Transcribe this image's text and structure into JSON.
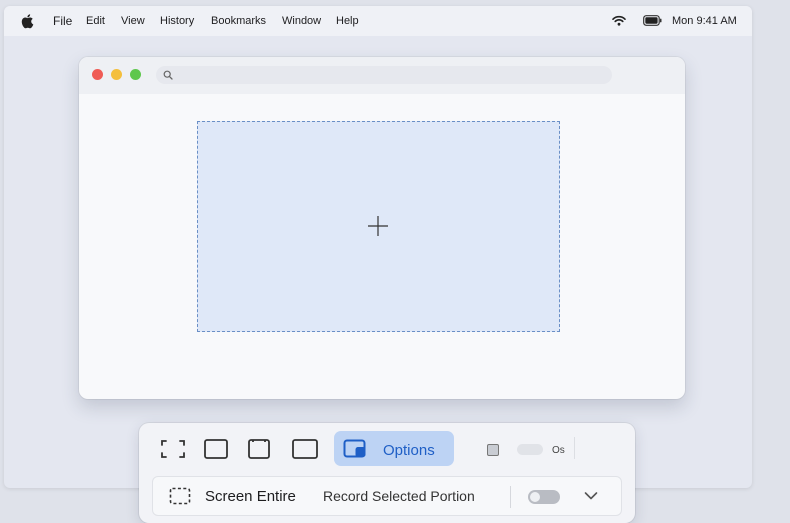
{
  "menubar": {
    "apple_icon": "apple-logo-icon",
    "items": [
      "File",
      "Edit",
      "View",
      "History",
      "Bookmarks",
      "Window",
      "Help"
    ],
    "wifi_icon": "wifi-icon",
    "battery_icon": "battery-icon",
    "clock": "Mon 9:41 AM"
  },
  "browser": {
    "search_placeholder": "",
    "search_icon": "search-icon",
    "crosshair_icon": "crosshair-icon"
  },
  "capture_toolbar": {
    "tools": [
      "capture-entire-screen-icon",
      "capture-window-icon",
      "capture-selection-icon",
      "record-entire-screen-icon"
    ],
    "options_label": "Options",
    "options_icon": "record-selection-icon",
    "toggle_label": "Os",
    "bottom": {
      "screen_entire_label": "Screen Entire",
      "record_selected_label": "Record Selected Portion",
      "toggle_on": false,
      "chevron_icon": "chevron-down-icon"
    },
    "accent_color": "#1f5fc6",
    "selection_fill": "#dfe8f8"
  }
}
